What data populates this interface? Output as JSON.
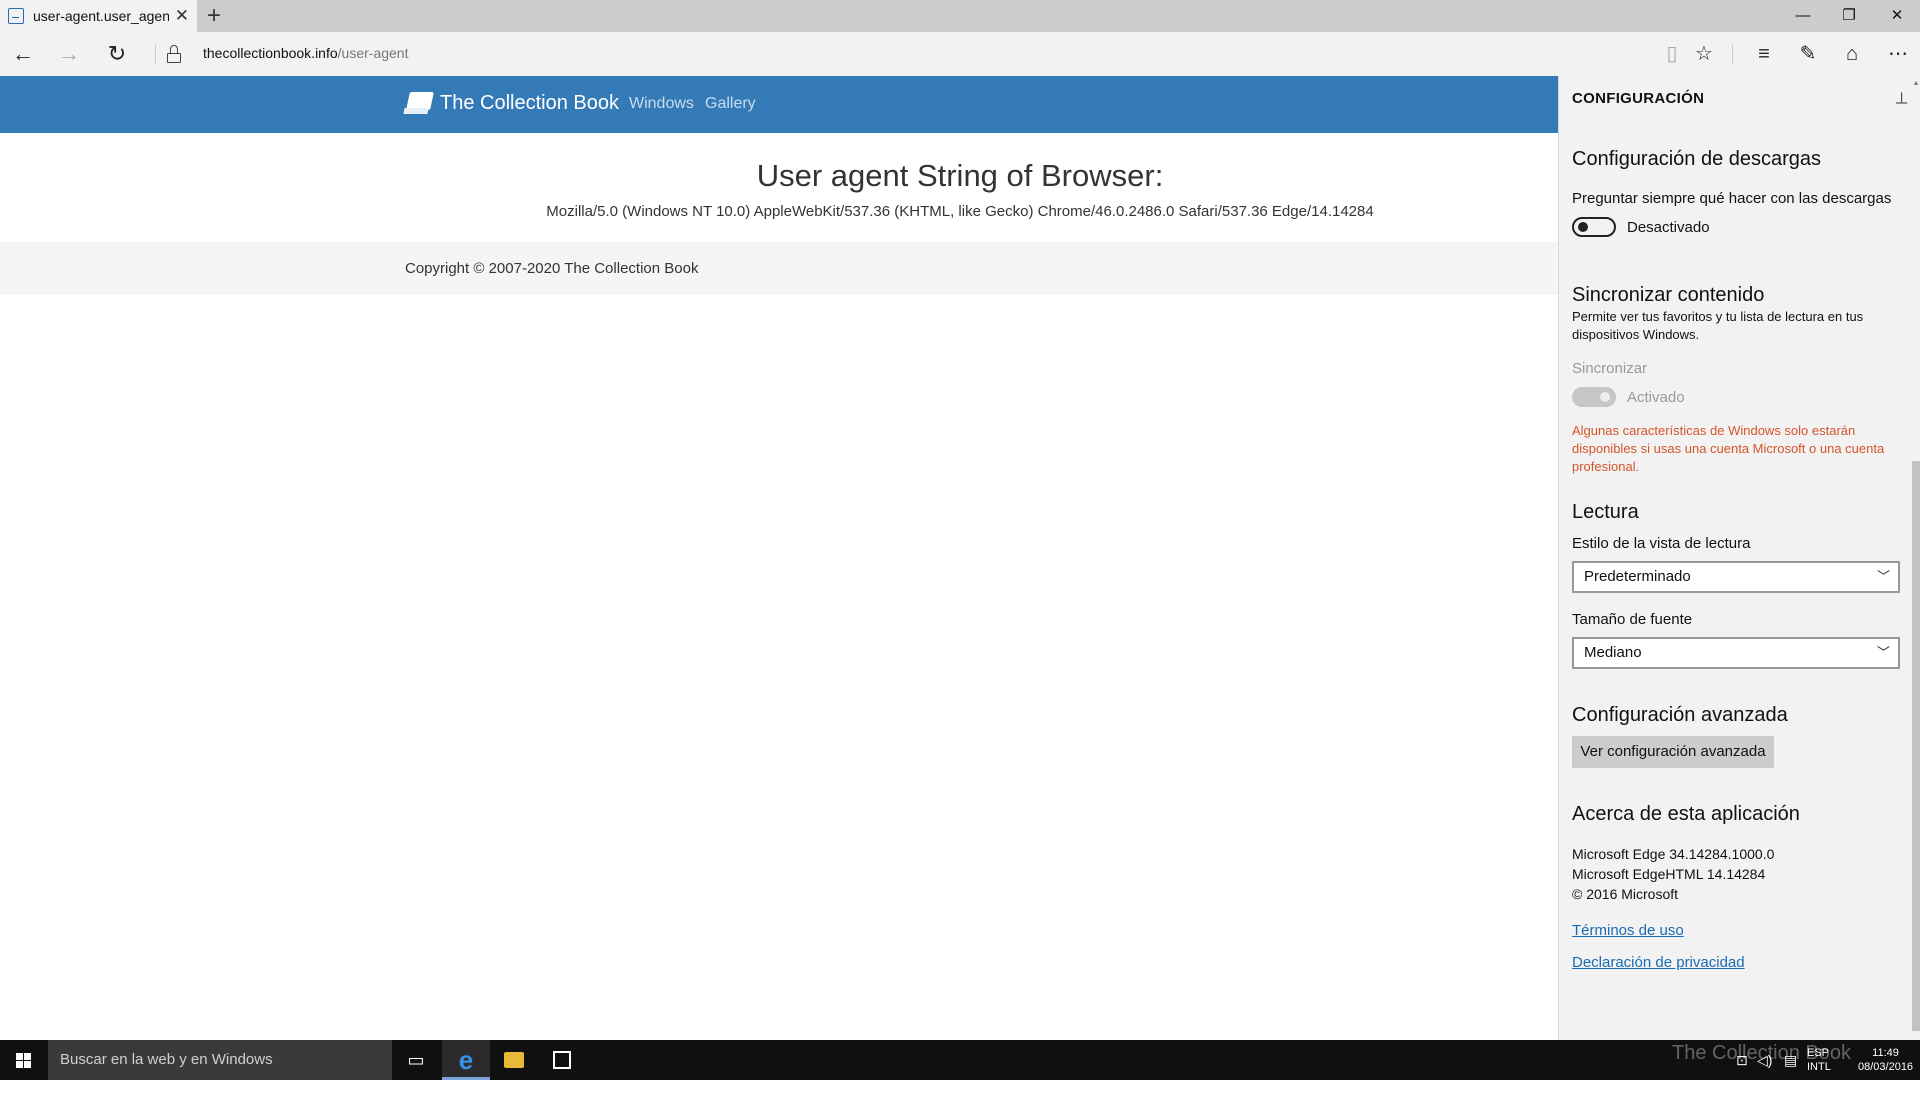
{
  "browser": {
    "tab_title": "user-agent.user_agent -",
    "url_host": "thecollectionbook.info",
    "url_path": "/user-agent",
    "accent": "#337ab7"
  },
  "site": {
    "brand": "The Collection Book",
    "nav": [
      "Windows",
      "Gallery"
    ],
    "heading": "User agent String of Browser:",
    "ua_string": "Mozilla/5.0 (Windows NT 10.0) AppleWebKit/537.36 (KHTML, like Gecko) Chrome/46.0.2486.0 Safari/537.36 Edge/14.14284",
    "copyright": "Copyright © 2007-2020 The Collection Book"
  },
  "settings": {
    "title": "CONFIGURACIÓN",
    "downloads": {
      "heading": "Configuración de descargas",
      "label": "Preguntar siempre qué hacer con las descargas",
      "toggle_state": "Desactivado"
    },
    "sync": {
      "heading": "Sincronizar contenido",
      "description": "Permite ver tus favoritos y tu lista de lectura en tus dispositivos Windows.",
      "label": "Sincronizar",
      "toggle_state": "Activado",
      "warning": "Algunas características de Windows solo estarán disponibles si usas una cuenta Microsoft o una cuenta profesional."
    },
    "reading": {
      "heading": "Lectura",
      "style_label": "Estilo de la vista de lectura",
      "style_value": "Predeterminado",
      "font_label": "Tamaño de fuente",
      "font_value": "Mediano"
    },
    "advanced": {
      "heading": "Configuración avanzada",
      "button": "Ver configuración avanzada"
    },
    "about": {
      "heading": "Acerca de esta aplicación",
      "line1": "Microsoft Edge 34.14284.1000.0",
      "line2": "Microsoft EdgeHTML 14.14284",
      "line3": "© 2016 Microsoft",
      "terms": "Términos de uso",
      "privacy": "Declaración de privacidad"
    }
  },
  "taskbar": {
    "search_placeholder": "Buscar en la web y en Windows",
    "lang_top": "ESP",
    "lang_bottom": "INTL",
    "time": "11:49",
    "date": "08/03/2016",
    "watermark": "The Collection Book"
  }
}
